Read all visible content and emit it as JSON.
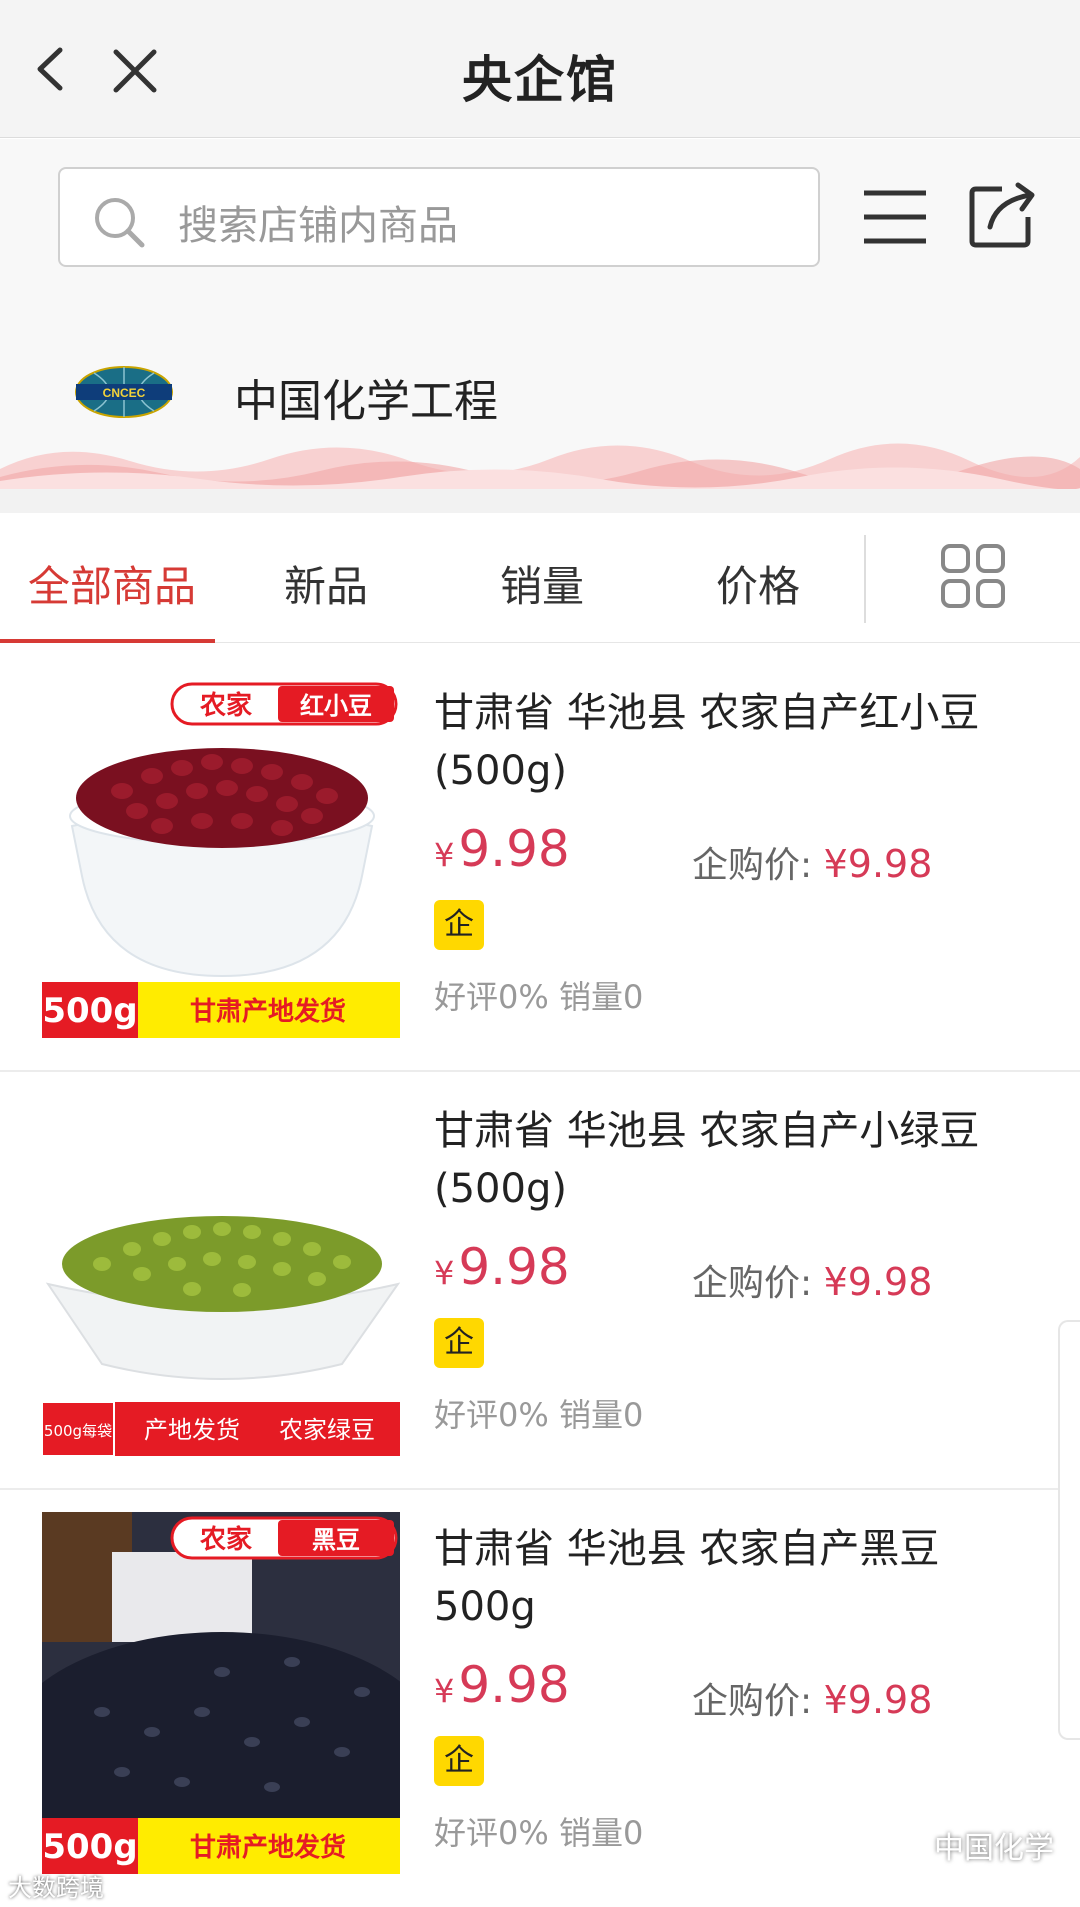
{
  "header": {
    "title": "央企馆"
  },
  "search": {
    "placeholder": "搜索店铺内商品"
  },
  "store": {
    "name": "中国化学工程",
    "logo_text": "CNCEC"
  },
  "tabs": [
    {
      "label": "全部商品",
      "active": true
    },
    {
      "label": "新品",
      "active": false
    },
    {
      "label": "销量",
      "active": false
    },
    {
      "label": "价格",
      "active": false
    }
  ],
  "products": [
    {
      "name": "甘肃省 华池县 农家自产红小豆(500g)",
      "currency": "¥",
      "price": "9.98",
      "corp_label": "企购价:",
      "corp_price": "¥9.98",
      "badge": "企",
      "stats": "好评0% 销量0",
      "img_tag_left": "农家",
      "img_tag_right": "红小豆",
      "img_bottom_left": "500g",
      "img_bottom_right": "甘肃产地发货"
    },
    {
      "name": "甘肃省 华池县 农家自产小绿豆(500g)",
      "currency": "¥",
      "price": "9.98",
      "corp_label": "企购价:",
      "corp_price": "¥9.98",
      "badge": "企",
      "stats": "好评0% 销量0",
      "img_bottom_left": "500g每袋",
      "img_bottom_mid": "产地发货",
      "img_bottom_right": "农家绿豆"
    },
    {
      "name": "甘肃省 华池县 农家自产黑豆500g",
      "currency": "¥",
      "price": "9.98",
      "corp_label": "企购价:",
      "corp_price": "¥9.98",
      "badge": "企",
      "stats": "好评0% 销量0",
      "img_tag_left": "农家",
      "img_tag_right": "黑豆",
      "img_bottom_left": "500g",
      "img_bottom_right": "甘肃产地发货"
    }
  ],
  "watermarks": {
    "right": "中国化学",
    "left": "大数跨境"
  },
  "colors": {
    "accent": "#d63a35",
    "price": "#d63a57",
    "badge": "#ffd800"
  }
}
